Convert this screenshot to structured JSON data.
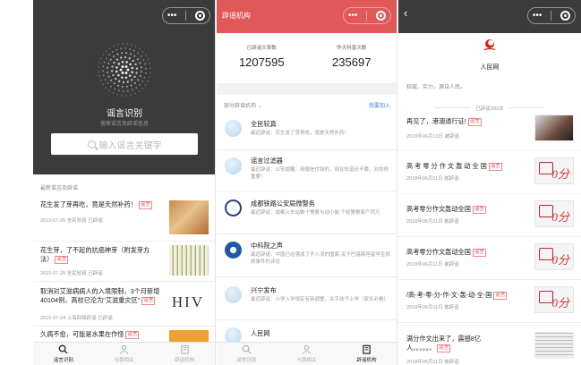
{
  "panel1": {
    "title": "谣言识别",
    "subtitle": "搜索谣言及辟谣信息",
    "search_placeholder": "输入谣言关键字",
    "section": "最新谣言及辟谣",
    "items": [
      {
        "title": "花生发了芽再吃，竟是天然补药！",
        "tag": "谣言",
        "meta": "2019-07-25 全民较真 已辟谣"
      },
      {
        "title": "花生芽，了不起的抗癌神芽（附发芽方法）",
        "tag": "谣言",
        "meta": "2019-07-25 全民较真 已辟谣"
      },
      {
        "title": "取消对艾滋病病人的入境限制，3个月新增40104例，高校已沦为\"艾滋重灾区\"",
        "tag": "谣言",
        "meta": "2019-07-24 上海网络辟谣 已辟谣"
      },
      {
        "title": "久病不愈，可能是水果在作怪",
        "tag": "谣言",
        "meta": ""
      }
    ],
    "tabs": [
      "谣言识别",
      "与我相关",
      "辟谣机构"
    ]
  },
  "panel2": {
    "title": "辟谣机构",
    "stat1_label": "已辟谣文章数",
    "stat1_value": "1207595",
    "stat2_label": "昨天科普次数",
    "stat2_value": "235697",
    "section": "部分辟谣机构",
    "join": "我要加入",
    "orgs": [
      {
        "name": "全民较真",
        "desc": "最近辟谣：花生发了芽再吃，竟是天然补药！"
      },
      {
        "name": "谣言过滤器",
        "desc": "最近辟谣：公安提醒：用微信付钱的，现在知道还不晚，对你很重要！"
      },
      {
        "name": "成都铁路公安局微警务",
        "desc": "最近辟谣：成都火车站数十警察与动小偷 个别警察家产丙万"
      },
      {
        "name": "中科院之声",
        "desc": "最近辟谣：中国已经落成了不入流的国家-关于巴基斯坦留学生视频事件的评论"
      },
      {
        "name": "兴宁发布",
        "desc": "最近辟谣：小学入学规定有新调整，关乎孩子上学（家长必看）"
      },
      {
        "name": "人民网",
        "desc": ""
      }
    ],
    "tabs": [
      "谣言识别",
      "与我相关",
      "辟谣机构"
    ]
  },
  "panel3": {
    "name": "人民网",
    "slogan": "权威、实力，源自人民。",
    "count": "已辟谣303次",
    "articles": [
      {
        "title": "再见了，港澳通行证!",
        "tag": "谣言",
        "meta": "2018年06月13日 被辟谣"
      },
      {
        "title": "高 考 零 分 作 文 轰 动 全 国",
        "tag": "谣言",
        "meta": "2018年06月11日 被辟谣"
      },
      {
        "title": "高考零分作文轰动全国",
        "tag": "谣言",
        "meta": "2018年06月11日 被辟谣"
      },
      {
        "title": "高考零分作文轰动全国",
        "tag": "谣言",
        "meta": "2018年06月11日 被辟谣"
      },
      {
        "title": "/高-考-零-分-作-文-轰-动-全-国",
        "tag": "谣言",
        "meta": "2018年06月11日 被辟谣"
      },
      {
        "title": "满分作文出来了，震撼8亿人。。。。。。",
        "tag": "谣言",
        "meta": "2018年06月11日 被辟谣"
      }
    ]
  },
  "capsule_dots": "•••",
  "back_symbol": "‹",
  "hiv_text": "HIV",
  "thumb_text": "0分"
}
